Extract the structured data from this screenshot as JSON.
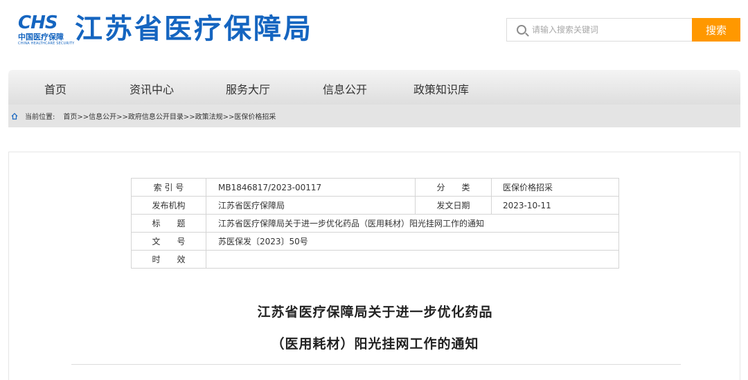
{
  "header": {
    "logo_mark": "CHS",
    "logo_cn": "中国医疗保障",
    "logo_en": "CHINA HEALTHCARE SECURITY",
    "site_title": "江苏省医疗保障局",
    "search_placeholder": "请输入搜索关键词",
    "search_button": "搜索"
  },
  "nav": {
    "items": [
      "首页",
      "资讯中心",
      "服务大厅",
      "信息公开",
      "政策知识库"
    ]
  },
  "breadcrumb": {
    "label": "当前位置:",
    "path": "首页>>信息公开>>政府信息公开目录>>政策法规>>医保价格招采"
  },
  "meta": {
    "index_label": "索 引 号",
    "index_value": "MB1846817/2023-00117",
    "category_label": "分　　类",
    "category_value": "医保价格招采",
    "publisher_label": "发布机构",
    "publisher_value": "江苏省医疗保障局",
    "date_label": "发文日期",
    "date_value": "2023-10-11",
    "title_label": "标　　题",
    "title_value": "江苏省医疗保障局关于进一步优化药品（医用耗材）阳光挂网工作的通知",
    "docno_label": "文　　号",
    "docno_value": "苏医保发〔2023〕50号",
    "validity_label": "时　　效",
    "validity_value": ""
  },
  "document": {
    "title_line1": "江苏省医疗保障局关于进一步优化药品",
    "title_line2": "（医用耗材）阳光挂网工作的通知"
  },
  "colors": {
    "brand": "#1565c0",
    "search_button": "#ff9800"
  }
}
